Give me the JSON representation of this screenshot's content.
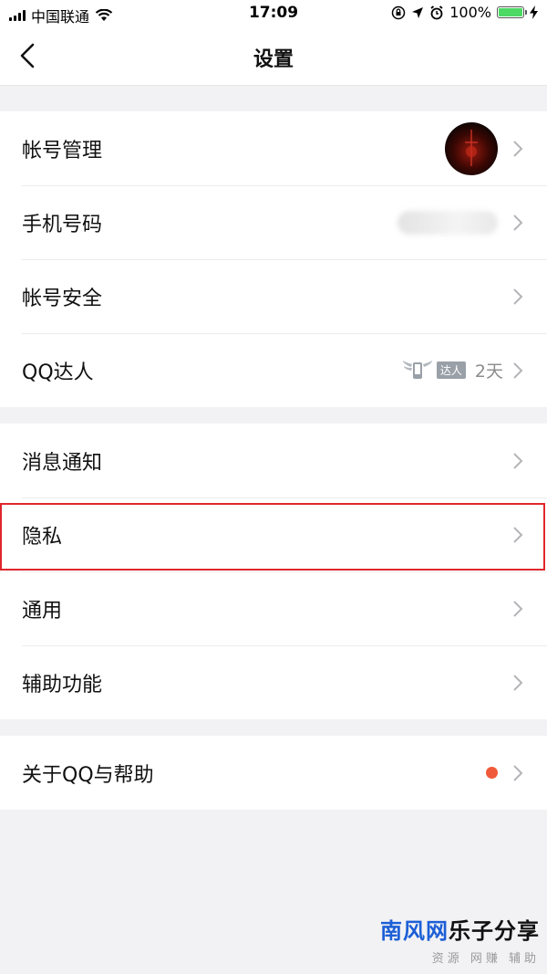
{
  "status_bar": {
    "carrier": "中国联通",
    "time": "17:09",
    "battery_text": "100%"
  },
  "nav": {
    "title": "设置"
  },
  "groups": [
    {
      "rows": [
        {
          "label": "帐号管理",
          "accessory": "avatar"
        },
        {
          "label": "手机号码",
          "accessory": "blurred-phone"
        },
        {
          "label": "帐号安全",
          "accessory": "none"
        },
        {
          "label": "QQ达人",
          "accessory": "badge",
          "badge_text": "达人",
          "days": "2天"
        }
      ]
    },
    {
      "rows": [
        {
          "label": "消息通知"
        },
        {
          "label": "隐私",
          "highlighted": true
        },
        {
          "label": "通用"
        },
        {
          "label": "辅助功能"
        }
      ]
    },
    {
      "rows": [
        {
          "label": "关于QQ与帮助",
          "accessory": "red-dot"
        }
      ]
    }
  ],
  "colors": {
    "highlight_border": "#e0262b",
    "red_dot": "#f05a3a",
    "battery_green": "#4cd964"
  },
  "watermark": {
    "brand_blue": "南风网",
    "brand_black": "乐子分享",
    "subtitle": "资源 网赚 辅助"
  }
}
